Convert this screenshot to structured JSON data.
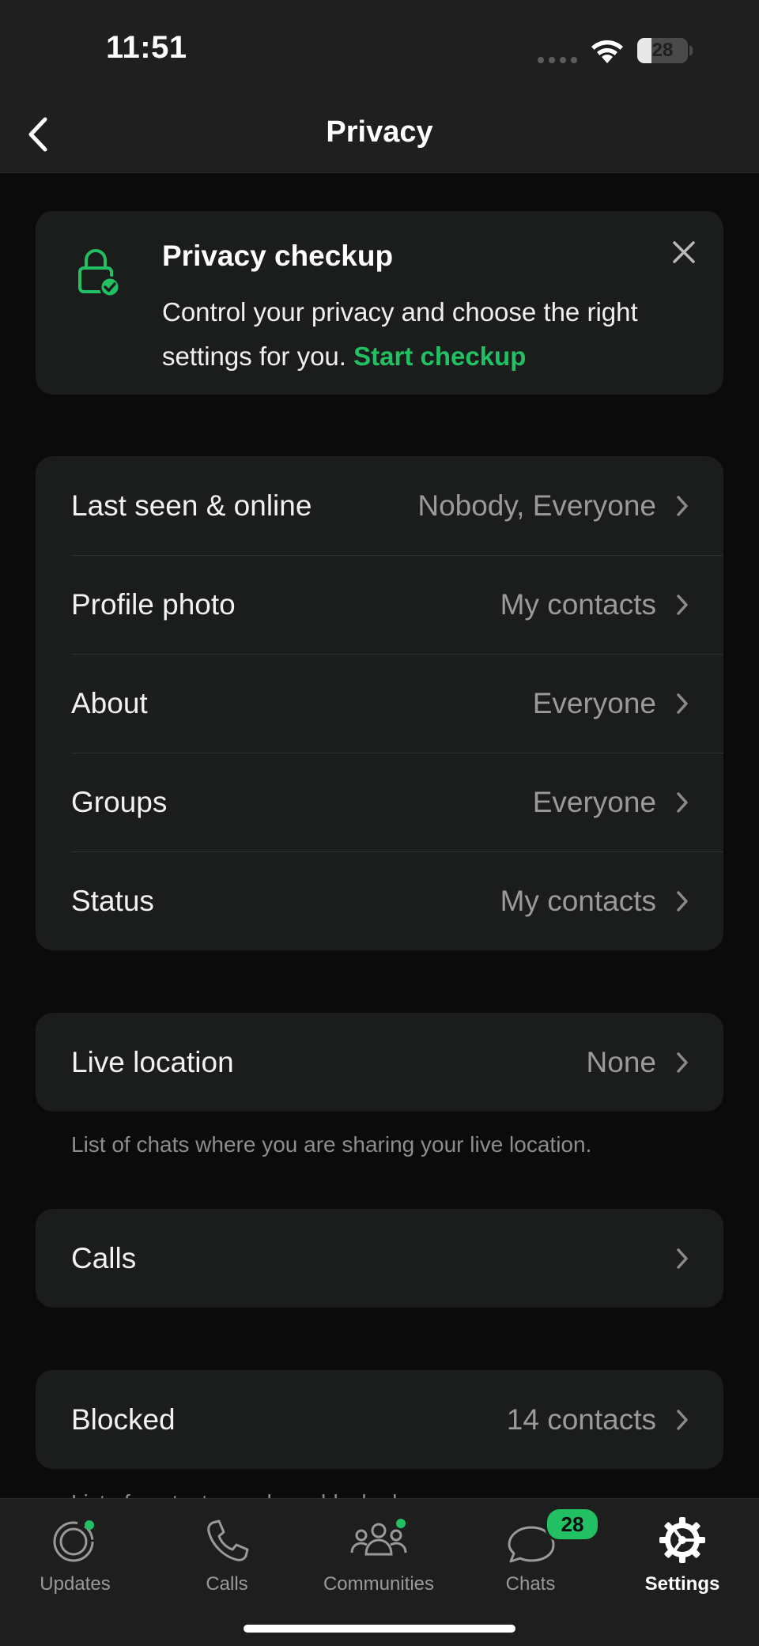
{
  "status_bar": {
    "time": "11:51",
    "battery_percent": "28",
    "battery_level": 0.28
  },
  "header": {
    "title": "Privacy",
    "back_icon": "chevron-left-icon"
  },
  "checkup": {
    "title": "Privacy checkup",
    "body": "Control your privacy and choose the right settings for you.",
    "link": "Start checkup",
    "icon": "lock-check-icon",
    "accent": "#21c063"
  },
  "privacy_settings": [
    {
      "label": "Last seen & online",
      "value": "Nobody, Everyone"
    },
    {
      "label": "Profile photo",
      "value": "My contacts"
    },
    {
      "label": "About",
      "value": "Everyone"
    },
    {
      "label": "Groups",
      "value": "Everyone"
    },
    {
      "label": "Status",
      "value": "My contacts"
    }
  ],
  "live_location": {
    "label": "Live location",
    "value": "None",
    "footnote": "List of chats where you are sharing your live location."
  },
  "calls": {
    "label": "Calls"
  },
  "blocked": {
    "label": "Blocked",
    "value": "14 contacts",
    "footnote_partial": "List of contacts you have blocked."
  },
  "tabs": [
    {
      "label": "Updates",
      "icon": "updates-icon",
      "active": false
    },
    {
      "label": "Calls",
      "icon": "phone-icon",
      "active": false
    },
    {
      "label": "Communities",
      "icon": "communities-icon",
      "active": false
    },
    {
      "label": "Chats",
      "icon": "chats-icon",
      "active": false,
      "badge": "28"
    },
    {
      "label": "Settings",
      "icon": "settings-gear-icon",
      "active": true
    }
  ]
}
